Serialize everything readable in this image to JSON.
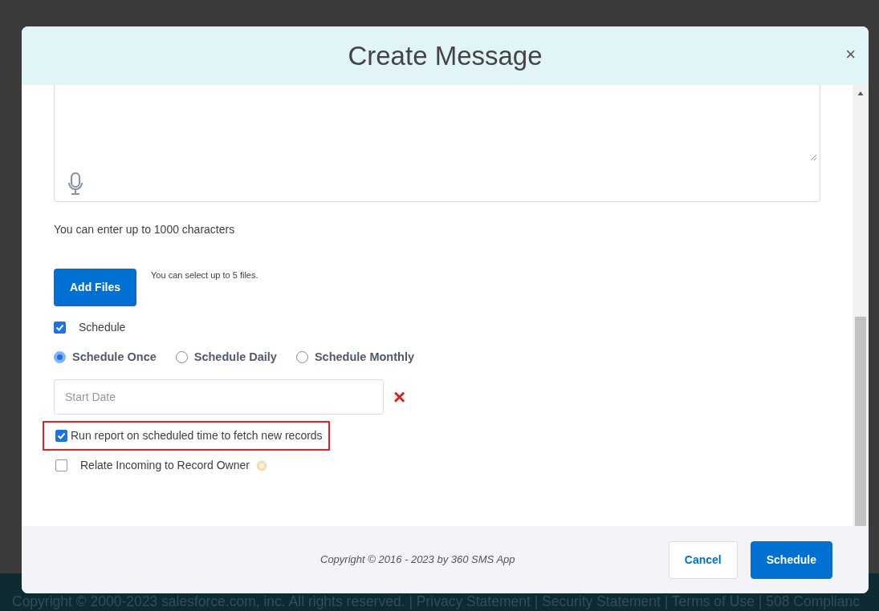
{
  "page_footer": {
    "text": "Copyright © 2000-2023 salesforce.com, inc. All rights reserved. | Privacy Statement | Security Statement | Terms of Use | 508 Complianc"
  },
  "modal": {
    "title": "Create Message",
    "close": "×"
  },
  "message": {
    "hint": "You can enter up to 1000 characters"
  },
  "files": {
    "button": "Add Files",
    "hint": "You can select up to 5 files."
  },
  "schedule": {
    "label": "Schedule",
    "checked": true
  },
  "frequency": [
    {
      "label": "Schedule Once",
      "selected": true
    },
    {
      "label": "Schedule Daily",
      "selected": false
    },
    {
      "label": "Schedule Monthly",
      "selected": false
    }
  ],
  "start_date": {
    "placeholder": "Start Date",
    "clear": "×"
  },
  "options": [
    {
      "label": "Run report on scheduled time to fetch new records",
      "checked": true,
      "highlighted": true
    },
    {
      "label": "Relate Incoming to Record Owner",
      "checked": false,
      "highlighted": false,
      "info": true
    }
  ],
  "footer": {
    "copyright": "Copyright © 2016 - 2023 by 360 SMS App",
    "buttons": [
      {
        "label": "Cancel",
        "kind": "secondary"
      },
      {
        "label": "Schedule",
        "kind": "primary"
      }
    ]
  }
}
